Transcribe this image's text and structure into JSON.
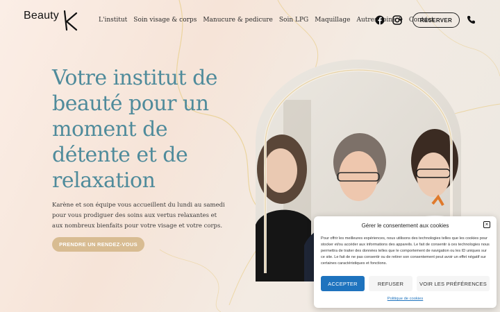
{
  "brand": {
    "logo_text": "Beauty",
    "logo_letter": "K"
  },
  "nav": {
    "items": [
      {
        "label": "L'institut"
      },
      {
        "label": "Soin visage & corps"
      },
      {
        "label": "Manucure & pedicure"
      },
      {
        "label": "Soin LPG"
      },
      {
        "label": "Maquillage"
      },
      {
        "label": "Autres soins"
      },
      {
        "label": "Contact"
      }
    ]
  },
  "header": {
    "reserve_label": "RÉSERVER",
    "icons": [
      "facebook-icon",
      "instagram-icon",
      "phone-icon"
    ]
  },
  "hero": {
    "title": "Votre institut de beauté pour un moment de détente et de relaxation",
    "text": "Karène et son équipe vous accueillent du lundi au samedi pour vous prodiguer des soins aux vertus relaxantes et aux nombreux bienfaits pour votre visage et votre corps.",
    "cta_label": "PRENDRE UN RENDEZ-VOUS"
  },
  "cookie": {
    "title": "Gérer le consentement aux cookies",
    "body": "Pour offrir les meilleures expériences, nous utilisons des technologies telles que les cookies pour stocker et/ou accéder aux informations des appareils. Le fait de consentir à ces technologies nous permettra de traiter des données telles que le comportement de navigation ou les ID uniques sur ce site. Le fait de ne pas consentir ou de retirer son consentement peut avoir un effet négatif sur certaines caractéristiques et fonctions.",
    "close_symbol": "×",
    "accept_label": "ACCEPTER",
    "refuse_label": "REFUSER",
    "prefs_label": "VOIR LES PRÉFÉRENCES",
    "policy_link": "Politique de cookies"
  },
  "colors": {
    "title": "#4f8b9b",
    "cta": "#d8bc92",
    "accept": "#1e73be",
    "marble_gold": "#e6c77f"
  }
}
